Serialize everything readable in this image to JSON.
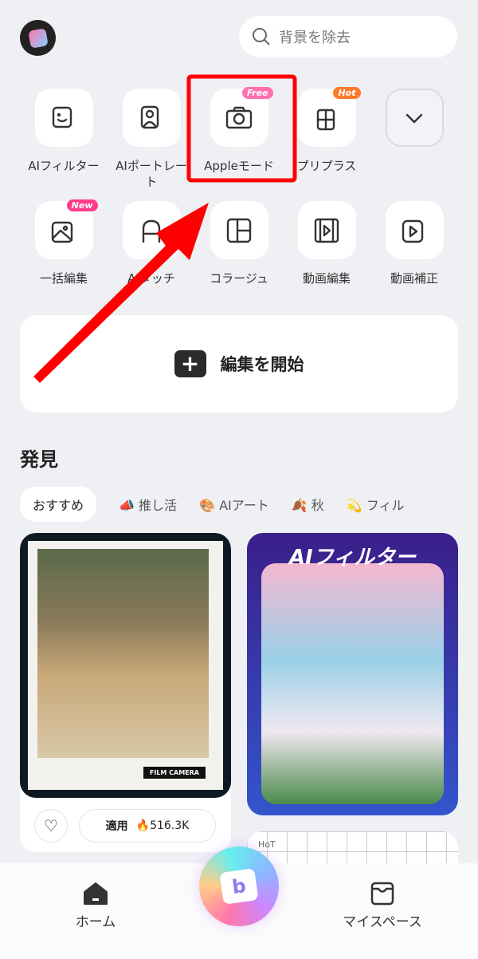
{
  "header": {
    "search_placeholder": "背景を除去"
  },
  "tools": [
    {
      "label": "AIフィルター",
      "icon": "ai-filter-icon"
    },
    {
      "label": "AIポートレート",
      "icon": "ai-portrait-icon"
    },
    {
      "label": "Appleモード",
      "icon": "camera-icon",
      "badge": "Free",
      "badge_color": "#ff6fb0"
    },
    {
      "label": "プリプラス",
      "icon": "grid-sparkle-icon",
      "badge": "Hot",
      "badge_color": "#ff7a2a"
    },
    {
      "label": "",
      "icon": "chevron-down-icon"
    },
    {
      "label": "一括編集",
      "icon": "batch-image-icon",
      "badge": "New",
      "badge_color": "#ff3d8a"
    },
    {
      "label": "AIタッチ",
      "icon": "ai-touch-icon"
    },
    {
      "label": "コラージュ",
      "icon": "collage-icon"
    },
    {
      "label": "動画編集",
      "icon": "video-edit-icon"
    },
    {
      "label": "動画補正",
      "icon": "video-ai-icon"
    }
  ],
  "edit_button": {
    "label": "編集を開始"
  },
  "discover": {
    "title": "発見",
    "chips": [
      {
        "emoji": "",
        "label": "おすすめ"
      },
      {
        "emoji": "📣",
        "label": "推し活"
      },
      {
        "emoji": "🎨",
        "label": "AIアート"
      },
      {
        "emoji": "🍂",
        "label": "秋"
      },
      {
        "emoji": "💫",
        "label": "フィル"
      }
    ]
  },
  "cards": {
    "card1": {
      "stamp": "FILM CAMERA",
      "apply_label": "適用",
      "uses": "516.3K"
    },
    "card2": {
      "title": "AIフィルター"
    },
    "card3": {
      "text": "HoT"
    }
  },
  "nav": {
    "home": "ホーム",
    "myspace": "マイスペース"
  },
  "annotation": {
    "color": "#ff0000"
  }
}
